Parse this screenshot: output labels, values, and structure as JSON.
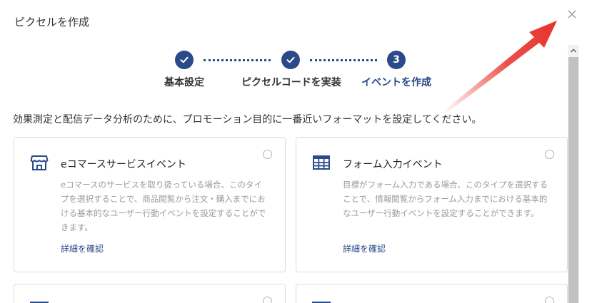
{
  "dialog": {
    "title": "ピクセルを作成",
    "close_icon": "close-icon"
  },
  "stepper": {
    "steps": [
      {
        "label": "基本設定",
        "state": "done",
        "mark": ""
      },
      {
        "label": "ピクセルコードを実装",
        "state": "done",
        "mark": ""
      },
      {
        "label": "イベントを作成",
        "state": "active",
        "mark": "3"
      }
    ]
  },
  "description": "効果測定と配信データ分析のために、プロモーション目的に一番近いフォーマットを設定してください。",
  "cards": [
    {
      "icon": "storefront-icon",
      "title": "eコマースサービスイベント",
      "body": "eコマースのサービスを取り扱っている場合、このタイプを選択することで、商品閲覧から注文・購入までにおける基本的なユーザー行動イベントを設定することができます。",
      "link": "詳細を確認"
    },
    {
      "icon": "table-form-icon",
      "title": "フォーム入力イベント",
      "body": "目標がフォーム入力である場合、このタイプを選択することで、情報閲覧からフォーム入力までにおける基本的なユーザー行動イベントを設定することができます。",
      "link": "詳細を確認"
    }
  ],
  "colors": {
    "accent": "#2a4a8a",
    "annotation_arrow": "#e8312b"
  }
}
